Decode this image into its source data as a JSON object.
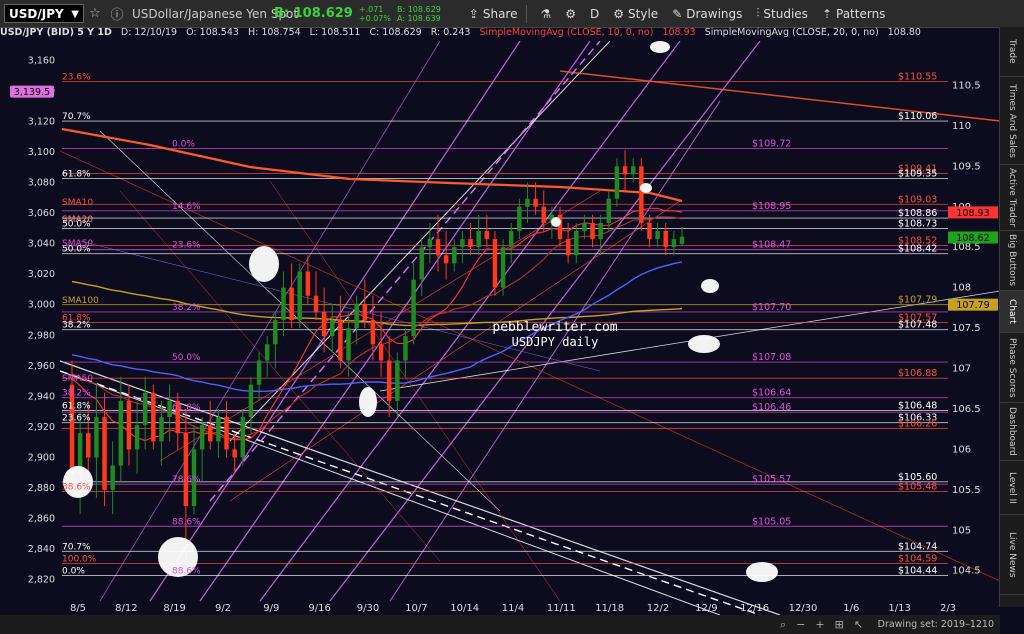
{
  "toolbar": {
    "symbol": "USD/JPY",
    "description": "USDollar/Japanese Yen Spot",
    "bid": "B: 108.629",
    "change_abs": "+.071",
    "change_pct": "+0.07%",
    "bid_small": "B: 108.629",
    "ask_small": "A: 108.639",
    "share_label": "Share",
    "period_label": "D",
    "style_label": "Style",
    "drawings_label": "Drawings",
    "studies_label": "Studies",
    "patterns_label": "Patterns"
  },
  "infobar": {
    "title": "USD/JPY (BID)  5 Y 1D",
    "date": "D: 12/10/19",
    "open": "O: 108.543",
    "high": "H: 108.754",
    "low": "L: 108.511",
    "close": "C: 108.629",
    "range": "R: 0.243",
    "sma10": "SimpleMovingAvg (CLOSE, 10, 0, no)",
    "sma10_val": "108.93",
    "sma20": "SimpleMovingAvg (CLOSE, 20, 0, no)",
    "sma20_val": "108.80"
  },
  "sidebar": {
    "tabs": [
      "Trade",
      "Times And Sales",
      "Active Trader",
      "Big Buttons",
      "Chart",
      "Phase Scores",
      "Dashboard",
      "Level II",
      "Live News"
    ]
  },
  "statusbar": {
    "drawing_set": "Drawing set: 2019–1210"
  },
  "colors": {
    "background": "#0c0c1e",
    "candle_up": "#1f8a1f",
    "candle_down": "#ff3a1a",
    "fib_white": "#ffffff",
    "fib_magenta": "#e050e0",
    "fib_red": "#ff4a3a",
    "channel_magenta": "#e070ff",
    "sma10": "#ff3333",
    "sma20": "#b03030",
    "sma50": "#5060ff",
    "sma100": "#c8a020",
    "sma200": "#ff5a2a"
  },
  "chart_data": {
    "type": "candlestick",
    "watermark": [
      "pebblewriter.com",
      "USDJPY daily"
    ],
    "left_axis": {
      "ticks": [
        3160,
        3140,
        3120,
        3100,
        3080,
        3060,
        3040,
        3020,
        3000,
        2980,
        2960,
        2940,
        2920,
        2900,
        2880,
        2860,
        2840,
        2820
      ],
      "tick_labels": [
        "3,160",
        "3,140",
        "3,120",
        "3,100",
        "3,080",
        "3,060",
        "3,040",
        "3,020",
        "3,000",
        "2,980",
        "2,960",
        "2,940",
        "2,920",
        "2,900",
        "2,880",
        "2,860",
        "2,840",
        "2,820"
      ],
      "marker": {
        "value": 3139.5,
        "label": "3,139.5"
      }
    },
    "right_axis": {
      "range": [
        104.2,
        111.0
      ],
      "ticks": [
        110.5,
        110,
        109.5,
        109,
        108.5,
        108,
        107.5,
        107,
        106.5,
        106,
        105.5,
        105,
        104.5
      ],
      "tick_labels": [
        "110.5",
        "110",
        "109.5",
        "109",
        "108.5",
        "108",
        "107.5",
        "107",
        "106.5",
        "106",
        "105.5",
        "105",
        "104.5"
      ],
      "markers": [
        {
          "value": 108.93,
          "label": "108.93",
          "color": "#ff3333"
        },
        {
          "value": 108.62,
          "label": "108.62",
          "color": "#1fa31f"
        },
        {
          "value": 107.79,
          "label": "107.79",
          "color": "#c8a020"
        }
      ]
    },
    "x_axis": {
      "labels": [
        "8/5",
        "8/12",
        "8/19",
        "9/2",
        "9/9",
        "9/16",
        "9/30",
        "10/7",
        "10/14",
        "11/4",
        "11/11",
        "11/18",
        "12/2",
        "12/9",
        "12/16",
        "12/30",
        "1/6",
        "1/13",
        "2/3"
      ]
    },
    "fib_percent_labels": [
      {
        "label": "23.6%",
        "value": 110.55,
        "color": "#ff5040",
        "col": 0
      },
      {
        "label": "70.7%",
        "value": 110.06,
        "color": "#ffffff",
        "col": 0
      },
      {
        "label": "0.0%",
        "value": 109.72,
        "color": "#e050e0",
        "col": 1
      },
      {
        "label": "61.8%",
        "value": 109.35,
        "color": "#ffffff",
        "col": 0
      },
      {
        "label": "14.6%",
        "value": 108.95,
        "color": "#e050e0",
        "col": 1
      },
      {
        "label": "50.0%",
        "value": 108.73,
        "color": "#ffffff",
        "col": 0
      },
      {
        "label": "23.6%",
        "value": 108.47,
        "color": "#e050e0",
        "col": 1
      },
      {
        "label": "50.0%",
        "value": 108.42,
        "color": "#ffffff",
        "col": 0
      },
      {
        "label": "38.2%",
        "value": 107.7,
        "color": "#e050e0",
        "col": 1
      },
      {
        "label": "61.8%",
        "value": 107.57,
        "color": "#ff5040",
        "col": 0
      },
      {
        "label": "38.2%",
        "value": 107.48,
        "color": "#ffffff",
        "col": 0
      },
      {
        "label": "50.0%",
        "value": 107.08,
        "color": "#e050e0",
        "col": 1
      },
      {
        "label": "38.2%",
        "value": 106.64,
        "color": "#e050e0",
        "col": 0
      },
      {
        "label": "61.8%",
        "value": 106.48,
        "color": "#ffffff",
        "col": 0
      },
      {
        "label": "61.8%",
        "value": 106.46,
        "color": "#e050e0",
        "col": 1
      },
      {
        "label": "23.6%",
        "value": 106.33,
        "color": "#ffffff",
        "col": 0
      },
      {
        "label": "78.6%",
        "value": 105.57,
        "color": "#e050e0",
        "col": 1
      },
      {
        "label": "38.6%",
        "value": 105.48,
        "color": "#ff5040",
        "col": 0
      },
      {
        "label": "88.6%",
        "value": 105.05,
        "color": "#e050e0",
        "col": 1
      },
      {
        "label": "70.7%",
        "value": 104.74,
        "color": "#ffffff",
        "col": 0
      },
      {
        "label": "100.0%",
        "value": 104.59,
        "color": "#ff5040",
        "col": 0
      },
      {
        "label": "0.0%",
        "value": 104.44,
        "color": "#ffffff",
        "col": 0
      },
      {
        "label": "88.6%",
        "value": 104.44,
        "color": "#e050e0",
        "col": 1
      }
    ],
    "price_levels": [
      {
        "label": "$110.55",
        "value": 110.55,
        "color": "#ff5040"
      },
      {
        "label": "$110.06",
        "value": 110.06,
        "color": "#ffffff"
      },
      {
        "label": "$109.72",
        "value": 109.72,
        "color": "#e050e0"
      },
      {
        "label": "$109.41",
        "value": 109.41,
        "color": "#ff5040"
      },
      {
        "label": "$109.35",
        "value": 109.35,
        "color": "#ffffff"
      },
      {
        "label": "$109.03",
        "value": 109.03,
        "color": "#ff5040"
      },
      {
        "label": "$108.95",
        "value": 108.95,
        "color": "#e050e0"
      },
      {
        "label": "$108.86",
        "value": 108.86,
        "color": "#ffffff"
      },
      {
        "label": "$108.73",
        "value": 108.73,
        "color": "#ffffff"
      },
      {
        "label": "$108.52",
        "value": 108.52,
        "color": "#ff5040"
      },
      {
        "label": "$108.47",
        "value": 108.47,
        "color": "#e050e0"
      },
      {
        "label": "$108.42",
        "value": 108.42,
        "color": "#ffffff"
      },
      {
        "label": "$107.79",
        "value": 107.79,
        "color": "#c8a020"
      },
      {
        "label": "$107.70",
        "value": 107.7,
        "color": "#e050e0"
      },
      {
        "label": "$107.57",
        "value": 107.57,
        "color": "#ff5040"
      },
      {
        "label": "$107.48",
        "value": 107.48,
        "color": "#ffffff"
      },
      {
        "label": "$107.08",
        "value": 107.08,
        "color": "#e050e0"
      },
      {
        "label": "$106.88",
        "value": 106.88,
        "color": "#ff5040"
      },
      {
        "label": "$106.64",
        "value": 106.64,
        "color": "#e050e0"
      },
      {
        "label": "$106.48",
        "value": 106.48,
        "color": "#ffffff"
      },
      {
        "label": "$106.46",
        "value": 106.46,
        "color": "#e050e0"
      },
      {
        "label": "$106.33",
        "value": 106.33,
        "color": "#ffffff"
      },
      {
        "label": "$106.26",
        "value": 106.26,
        "color": "#ff5040"
      },
      {
        "label": "$105.60",
        "value": 105.6,
        "color": "#ffffff"
      },
      {
        "label": "$105.57",
        "value": 105.57,
        "color": "#e050e0"
      },
      {
        "label": "$105.48",
        "value": 105.48,
        "color": "#ff5040"
      },
      {
        "label": "$105.05",
        "value": 105.05,
        "color": "#e050e0"
      },
      {
        "label": "$104.74",
        "value": 104.74,
        "color": "#ffffff"
      },
      {
        "label": "$104.59",
        "value": 104.59,
        "color": "#ff5040"
      },
      {
        "label": "$104.44",
        "value": 104.44,
        "color": "#ffffff"
      }
    ],
    "sma_labels": [
      {
        "label": "SMA10",
        "value": 109.06,
        "color": "#ff5040"
      },
      {
        "label": "SMA20",
        "value": 108.85,
        "color": "#ff8080"
      },
      {
        "label": "SMA50",
        "value": 108.55,
        "color": "#e050e0"
      },
      {
        "label": "SMA100",
        "value": 107.85,
        "color": "#c8a020"
      },
      {
        "label": "SMA50",
        "value": 106.88,
        "color": "#e050e0"
      }
    ],
    "candles": [
      {
        "o": 106.8,
        "h": 107.1,
        "l": 105.5,
        "c": 105.7
      },
      {
        "o": 105.7,
        "h": 106.5,
        "l": 105.2,
        "c": 106.2
      },
      {
        "o": 106.2,
        "h": 106.6,
        "l": 105.6,
        "c": 105.9
      },
      {
        "o": 105.9,
        "h": 106.8,
        "l": 105.4,
        "c": 106.4
      },
      {
        "o": 106.4,
        "h": 106.7,
        "l": 105.3,
        "c": 105.5
      },
      {
        "o": 105.5,
        "h": 106.1,
        "l": 105.2,
        "c": 105.8
      },
      {
        "o": 105.8,
        "h": 106.9,
        "l": 105.6,
        "c": 106.6
      },
      {
        "o": 106.6,
        "h": 106.8,
        "l": 105.8,
        "c": 106.0
      },
      {
        "o": 106.0,
        "h": 106.6,
        "l": 105.7,
        "c": 106.3
      },
      {
        "o": 106.3,
        "h": 106.9,
        "l": 106.0,
        "c": 106.7
      },
      {
        "o": 106.7,
        "h": 106.8,
        "l": 106.0,
        "c": 106.1
      },
      {
        "o": 106.1,
        "h": 106.6,
        "l": 105.8,
        "c": 106.4
      },
      {
        "o": 106.4,
        "h": 106.8,
        "l": 106.1,
        "c": 106.6
      },
      {
        "o": 106.6,
        "h": 106.7,
        "l": 106.0,
        "c": 106.2
      },
      {
        "o": 106.2,
        "h": 106.5,
        "l": 104.6,
        "c": 105.3
      },
      {
        "o": 105.3,
        "h": 106.3,
        "l": 105.2,
        "c": 106.0
      },
      {
        "o": 106.0,
        "h": 106.4,
        "l": 105.6,
        "c": 106.3
      },
      {
        "o": 106.3,
        "h": 106.6,
        "l": 106.0,
        "c": 106.1
      },
      {
        "o": 106.1,
        "h": 106.5,
        "l": 105.9,
        "c": 106.4
      },
      {
        "o": 106.4,
        "h": 106.6,
        "l": 105.9,
        "c": 106.0
      },
      {
        "o": 106.0,
        "h": 106.2,
        "l": 105.7,
        "c": 105.9
      },
      {
        "o": 105.9,
        "h": 106.5,
        "l": 105.8,
        "c": 106.4
      },
      {
        "o": 106.4,
        "h": 106.9,
        "l": 106.2,
        "c": 106.8
      },
      {
        "o": 106.8,
        "h": 107.2,
        "l": 106.6,
        "c": 107.1
      },
      {
        "o": 107.1,
        "h": 107.4,
        "l": 106.9,
        "c": 107.3
      },
      {
        "o": 107.3,
        "h": 107.7,
        "l": 107.0,
        "c": 107.6
      },
      {
        "o": 107.6,
        "h": 108.2,
        "l": 107.4,
        "c": 108.0
      },
      {
        "o": 108.0,
        "h": 108.3,
        "l": 107.5,
        "c": 107.6
      },
      {
        "o": 107.6,
        "h": 108.3,
        "l": 107.5,
        "c": 108.2
      },
      {
        "o": 108.2,
        "h": 108.4,
        "l": 107.8,
        "c": 107.9
      },
      {
        "o": 107.9,
        "h": 108.2,
        "l": 107.6,
        "c": 107.7
      },
      {
        "o": 107.7,
        "h": 108.0,
        "l": 107.2,
        "c": 107.4
      },
      {
        "o": 107.4,
        "h": 107.8,
        "l": 107.2,
        "c": 107.6
      },
      {
        "o": 107.6,
        "h": 107.9,
        "l": 107.0,
        "c": 107.1
      },
      {
        "o": 107.1,
        "h": 107.7,
        "l": 106.9,
        "c": 107.5
      },
      {
        "o": 107.5,
        "h": 107.9,
        "l": 107.3,
        "c": 107.8
      },
      {
        "o": 107.8,
        "h": 108.1,
        "l": 107.5,
        "c": 107.6
      },
      {
        "o": 107.6,
        "h": 107.9,
        "l": 107.1,
        "c": 107.3
      },
      {
        "o": 107.3,
        "h": 107.7,
        "l": 106.9,
        "c": 107.1
      },
      {
        "o": 107.1,
        "h": 107.4,
        "l": 106.4,
        "c": 106.6
      },
      {
        "o": 106.6,
        "h": 107.2,
        "l": 106.4,
        "c": 107.1
      },
      {
        "o": 107.1,
        "h": 107.5,
        "l": 106.9,
        "c": 107.4
      },
      {
        "o": 107.4,
        "h": 108.3,
        "l": 107.3,
        "c": 108.1
      },
      {
        "o": 108.1,
        "h": 108.6,
        "l": 107.9,
        "c": 108.5
      },
      {
        "o": 108.5,
        "h": 108.8,
        "l": 108.3,
        "c": 108.6
      },
      {
        "o": 108.6,
        "h": 108.9,
        "l": 108.2,
        "c": 108.4
      },
      {
        "o": 108.4,
        "h": 108.7,
        "l": 108.1,
        "c": 108.3
      },
      {
        "o": 108.3,
        "h": 108.6,
        "l": 108.2,
        "c": 108.5
      },
      {
        "o": 108.5,
        "h": 108.7,
        "l": 108.3,
        "c": 108.6
      },
      {
        "o": 108.6,
        "h": 108.8,
        "l": 108.4,
        "c": 108.5
      },
      {
        "o": 108.5,
        "h": 108.9,
        "l": 108.4,
        "c": 108.7
      },
      {
        "o": 108.7,
        "h": 108.9,
        "l": 108.5,
        "c": 108.6
      },
      {
        "o": 108.6,
        "h": 108.7,
        "l": 107.9,
        "c": 108.0
      },
      {
        "o": 108.0,
        "h": 108.6,
        "l": 107.9,
        "c": 108.5
      },
      {
        "o": 108.5,
        "h": 108.8,
        "l": 108.3,
        "c": 108.7
      },
      {
        "o": 108.7,
        "h": 109.1,
        "l": 108.6,
        "c": 109.0
      },
      {
        "o": 109.0,
        "h": 109.3,
        "l": 108.8,
        "c": 109.1
      },
      {
        "o": 109.1,
        "h": 109.3,
        "l": 108.9,
        "c": 109.0
      },
      {
        "o": 109.0,
        "h": 109.2,
        "l": 108.7,
        "c": 108.8
      },
      {
        "o": 108.8,
        "h": 109.0,
        "l": 108.6,
        "c": 108.9
      },
      {
        "o": 108.9,
        "h": 109.0,
        "l": 108.5,
        "c": 108.6
      },
      {
        "o": 108.6,
        "h": 108.8,
        "l": 108.3,
        "c": 108.4
      },
      {
        "o": 108.4,
        "h": 108.8,
        "l": 108.3,
        "c": 108.7
      },
      {
        "o": 108.7,
        "h": 108.9,
        "l": 108.6,
        "c": 108.8
      },
      {
        "o": 108.8,
        "h": 108.9,
        "l": 108.5,
        "c": 108.6
      },
      {
        "o": 108.6,
        "h": 108.9,
        "l": 108.4,
        "c": 108.8
      },
      {
        "o": 108.8,
        "h": 109.2,
        "l": 108.7,
        "c": 109.1
      },
      {
        "o": 109.1,
        "h": 109.6,
        "l": 109.0,
        "c": 109.5
      },
      {
        "o": 109.5,
        "h": 109.7,
        "l": 109.2,
        "c": 109.4
      },
      {
        "o": 109.4,
        "h": 109.6,
        "l": 109.3,
        "c": 109.5
      },
      {
        "o": 109.5,
        "h": 109.6,
        "l": 108.7,
        "c": 108.8
      },
      {
        "o": 108.8,
        "h": 108.9,
        "l": 108.5,
        "c": 108.6
      },
      {
        "o": 108.6,
        "h": 108.8,
        "l": 108.5,
        "c": 108.7
      },
      {
        "o": 108.7,
        "h": 108.8,
        "l": 108.4,
        "c": 108.5
      },
      {
        "o": 108.5,
        "h": 108.7,
        "l": 108.4,
        "c": 108.6
      },
      {
        "o": 108.54,
        "h": 108.75,
        "l": 108.51,
        "c": 108.63
      }
    ]
  }
}
